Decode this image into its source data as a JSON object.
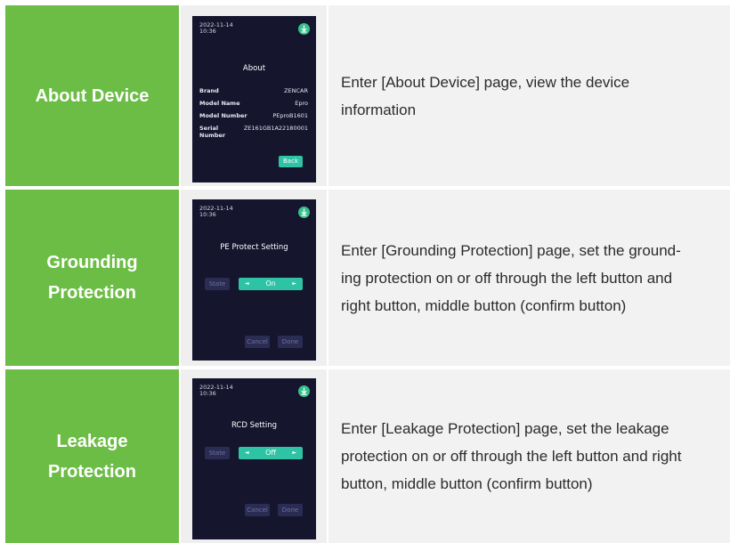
{
  "rows": [
    {
      "label_lines": [
        "About Device"
      ],
      "description_lines": [
        "Enter [About Device] page, view the device",
        "information"
      ],
      "screen": {
        "date": "2022-11-14",
        "time": "10:36",
        "title": "About",
        "info": [
          {
            "key": "Brand",
            "value": "ZENCAR"
          },
          {
            "key": "Model Name",
            "value": "Epro"
          },
          {
            "key": "Model Number",
            "value": "PEproB1601"
          },
          {
            "key": "Serial Number",
            "value": "ZE161GB1A22180001"
          }
        ],
        "back_label": "Back"
      }
    },
    {
      "label_lines": [
        "Grounding",
        "Protection"
      ],
      "description_lines": [
        "Enter [Grounding Protection] page, set the ground-",
        "ing protection on or off through the left button and",
        "right button, middle button (confirm button)"
      ],
      "screen": {
        "date": "2022-11-14",
        "time": "10:36",
        "title": "PE Protect Setting",
        "state_label": "State",
        "value": "On",
        "left_arrow": "◄",
        "right_arrow": "►",
        "cancel_label": "Cancel",
        "done_label": "Done"
      }
    },
    {
      "label_lines": [
        "Leakage",
        "Protection"
      ],
      "description_lines": [
        "Enter [Leakage Protection] page, set the leakage",
        "protection on or off through the left button and right",
        "button, middle button (confirm button)"
      ],
      "screen": {
        "date": "2022-11-14",
        "time": "10:36",
        "title": "RCD Setting",
        "state_label": "State",
        "value": "Off",
        "left_arrow": "◄",
        "right_arrow": "►",
        "cancel_label": "Cancel",
        "done_label": "Done"
      }
    }
  ],
  "colors": {
    "label_bg": "#6cbd45",
    "screen_bg": "#15152e",
    "accent": "#2ec3a4",
    "icon": "#34c08a"
  },
  "icons": [
    "download-icon"
  ]
}
